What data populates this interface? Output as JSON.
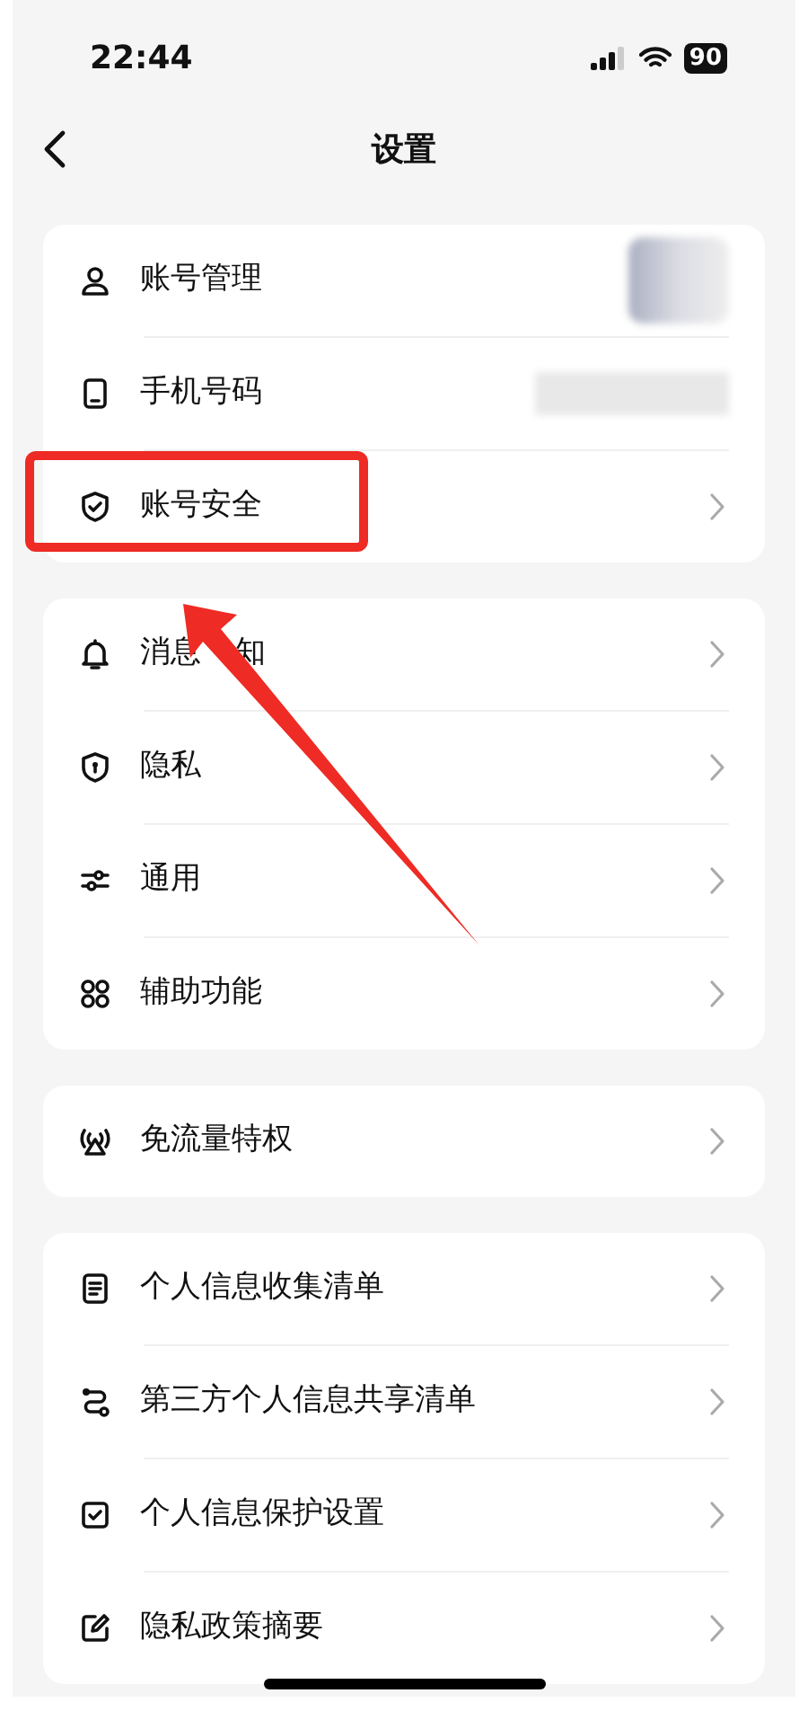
{
  "status_bar": {
    "time": "22:44",
    "battery": "90"
  },
  "header": {
    "title": "设置"
  },
  "groups": [
    {
      "items": [
        {
          "label": "账号管理",
          "kind": "avatar",
          "highlighted": false
        },
        {
          "label": "手机号码",
          "kind": "value",
          "highlighted": false
        },
        {
          "label": "账号安全",
          "kind": "chevron",
          "highlighted": true
        }
      ]
    },
    {
      "items": [
        {
          "label": "消息",
          "label_after_arrow": "知",
          "kind": "chevron",
          "highlighted": false
        },
        {
          "label": "隐私",
          "kind": "chevron",
          "highlighted": false
        },
        {
          "label": "通用",
          "kind": "chevron",
          "highlighted": false
        },
        {
          "label": "辅助功能",
          "kind": "chevron",
          "highlighted": false
        }
      ]
    },
    {
      "items": [
        {
          "label": "免流量特权",
          "kind": "chevron",
          "highlighted": false
        }
      ]
    },
    {
      "items": [
        {
          "label": "个人信息收集清单",
          "kind": "chevron",
          "highlighted": false
        },
        {
          "label": "第三方个人信息共享清单",
          "kind": "chevron",
          "highlighted": false
        },
        {
          "label": "个人信息保护设置",
          "kind": "chevron",
          "highlighted": false
        },
        {
          "label": "隐私政策摘要",
          "kind": "chevron",
          "highlighted": false
        }
      ]
    }
  ]
}
